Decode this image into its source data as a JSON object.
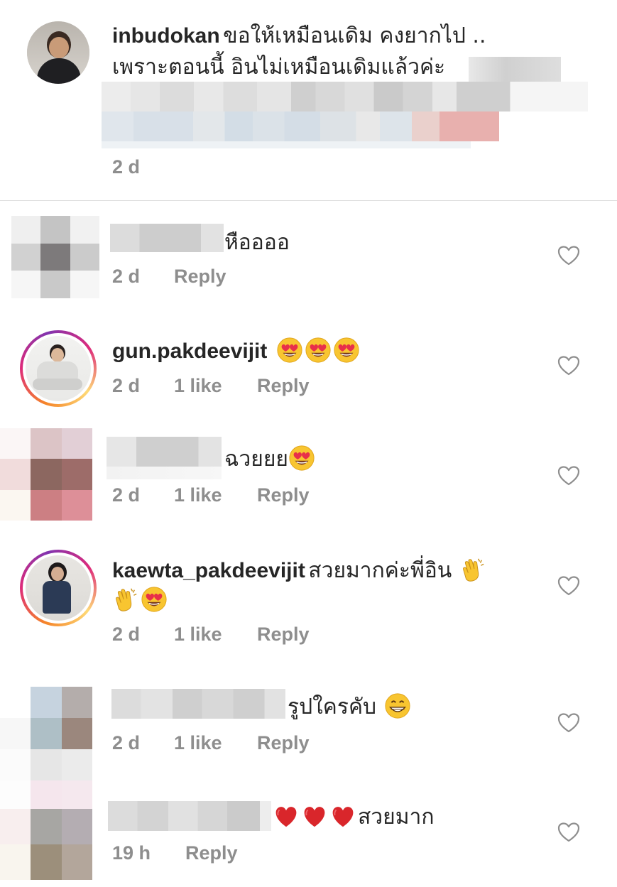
{
  "caption": {
    "username": "inbudokan",
    "text_line1": "ขอให้เหมือนเดิม คงยากไป ..",
    "text_line2": "เพราะตอนนี้ อินไม่เหมือนเดิมแล้วค่ะ",
    "time": "2 d"
  },
  "comments": [
    {
      "username": "",
      "text": "หืออออ",
      "time": "2 d",
      "likes": "",
      "reply": "Reply"
    },
    {
      "username": "gun.pakdeevijit",
      "text": "",
      "time": "2 d",
      "likes": "1 like",
      "reply": "Reply"
    },
    {
      "username": "",
      "text": "ฉวยยย",
      "time": "2 d",
      "likes": "1 like",
      "reply": "Reply"
    },
    {
      "username": "kaewta_pakdeevijit",
      "text": "สวยมากค่ะพี่อิน",
      "time": "2 d",
      "likes": "1 like",
      "reply": "Reply"
    },
    {
      "username": "",
      "text": "รูปใครคับ",
      "time": "2 d",
      "likes": "1 like",
      "reply": "Reply"
    },
    {
      "username": "",
      "text": "สวยมาก",
      "time": "19 h",
      "likes": "",
      "reply": "Reply"
    }
  ],
  "icons": {
    "like": "heart-outline-icon",
    "emoji_heart_eyes": "heart-eyes-emoji",
    "emoji_clap": "clapping-hands-emoji",
    "emoji_grin": "grinning-emoji",
    "emoji_red_heart": "red-heart-emoji"
  },
  "colors": {
    "text": "#262626",
    "meta": "#8e8e8e",
    "divider": "#dbdbdb",
    "heart_emoji": "#d9262b",
    "story_ring": "#dd2a7b"
  }
}
